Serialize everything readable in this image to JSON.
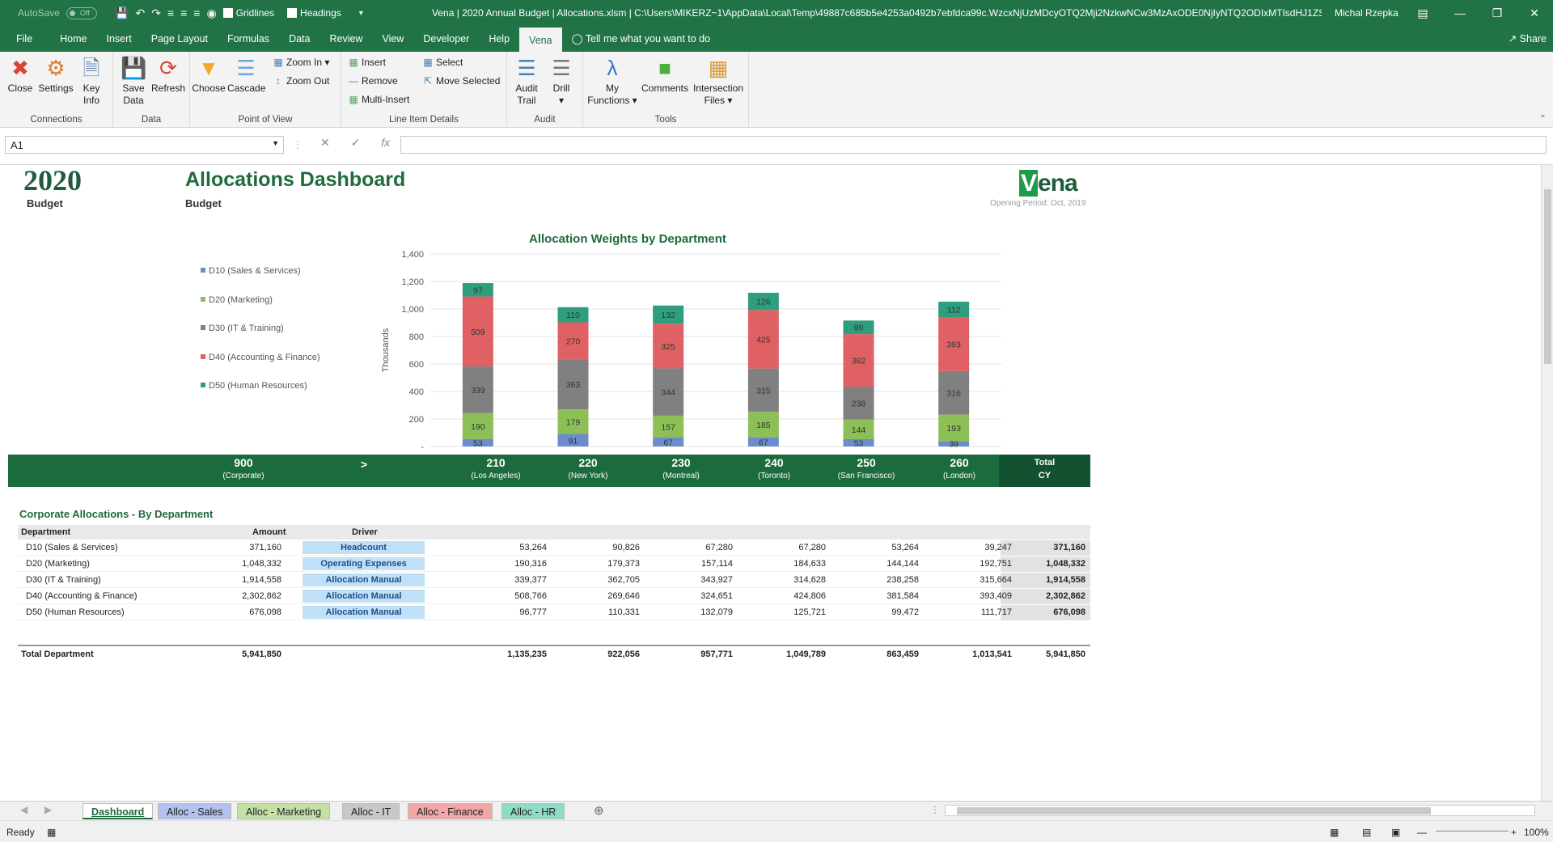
{
  "titlebar": {
    "autosave": "AutoSave",
    "autosave_state": "Off",
    "gridlines": "Gridlines",
    "headings": "Headings",
    "title": "Vena | 2020 Annual Budget | Allocations.xlsm | C:\\Users\\MIKERZ~1\\AppData\\Local\\Temp\\49887c685b5e4253a0492b7ebfdca99c.WzcxNjUzMDcyOTQ2Mji2NzkwNCw3MzAxODE0NjIyNTQ2ODIxMTIsdHJ1ZSwiY...",
    "user": "Michal Rzepka"
  },
  "tabs": [
    "File",
    "Home",
    "Insert",
    "Page Layout",
    "Formulas",
    "Data",
    "Review",
    "View",
    "Developer",
    "Help",
    "Vena"
  ],
  "tell_me": "Tell me what you want to do",
  "share": "Share",
  "ribbon": {
    "connections": {
      "label": "Connections",
      "close": "Close",
      "settings": "Settings",
      "key": "Key",
      "info": "Info"
    },
    "data": {
      "label": "Data",
      "save": "Save",
      "save2": "Data",
      "refresh": "Refresh"
    },
    "pov": {
      "label": "Point of View",
      "choose": "Choose",
      "cascade": "Cascade",
      "zoom_in": "Zoom In",
      "zoom_out": "Zoom Out"
    },
    "lid": {
      "label": "Line Item Details",
      "insert": "Insert",
      "remove": "Remove",
      "multi": "Multi-Insert",
      "select": "Select",
      "move": "Move Selected"
    },
    "audit": {
      "label": "Audit",
      "audit": "Audit",
      "trail": "Trail",
      "drill": "Drill"
    },
    "tools": {
      "label": "Tools",
      "my": "My",
      "functions": "Functions",
      "comments": "Comments",
      "intersection": "Intersection",
      "files": "Files"
    }
  },
  "namebox": "A1",
  "sheet": {
    "year": "2020",
    "budget1": "Budget",
    "title": "Allocations Dashboard",
    "budget2": "Budget",
    "logo": "ena",
    "opening": "Opening Period: Oct, 2019"
  },
  "chart_data": {
    "type": "bar",
    "title": "Allocation Weights by Department",
    "ylabel": "Thousands",
    "ylim": [
      0,
      1400
    ],
    "yticks": [
      "-",
      "200",
      "400",
      "600",
      "800",
      "1,000",
      "1,200",
      "1,400"
    ],
    "categories": [
      "210",
      "220",
      "230",
      "240",
      "250",
      "260"
    ],
    "series": [
      {
        "name": "D10 (Sales & Services)",
        "color": "#6c8ccb",
        "values": [
          53,
          91,
          67,
          67,
          53,
          39
        ]
      },
      {
        "name": "D20 (Marketing)",
        "color": "#8dbf57",
        "values": [
          190,
          179,
          157,
          185,
          144,
          193
        ]
      },
      {
        "name": "D30 (IT & Training)",
        "color": "#808080",
        "values": [
          339,
          363,
          344,
          315,
          238,
          316
        ]
      },
      {
        "name": "D40 (Accounting & Finance)",
        "color": "#e06164",
        "values": [
          509,
          270,
          325,
          425,
          382,
          393
        ]
      },
      {
        "name": "D50 (Human Resources)",
        "color": "#2e9e7f",
        "values": [
          97,
          110,
          132,
          126,
          99,
          112
        ]
      }
    ]
  },
  "band": {
    "c0": "900",
    "c0s": "(Corporate)",
    "arrow": ">",
    "cols": [
      {
        "n": "210",
        "s": "(Los Angeles)"
      },
      {
        "n": "220",
        "s": "(New York)"
      },
      {
        "n": "230",
        "s": "(Montreal)"
      },
      {
        "n": "240",
        "s": "(Toronto)"
      },
      {
        "n": "250",
        "s": "(San Francisco)"
      },
      {
        "n": "260",
        "s": "(London)"
      }
    ],
    "tot1": "Total",
    "tot2": "CY"
  },
  "table": {
    "title": "Corporate Allocations - By Department",
    "h_dept": "Department",
    "h_amount": "Amount",
    "h_driver": "Driver",
    "rows": [
      {
        "dept": "D10 (Sales & Services)",
        "amount": "371,160",
        "driver": "Headcount",
        "vals": [
          "53,264",
          "90,826",
          "67,280",
          "67,280",
          "53,264",
          "39,247"
        ],
        "total": "371,160"
      },
      {
        "dept": "D20 (Marketing)",
        "amount": "1,048,332",
        "driver": "Operating Expenses",
        "vals": [
          "190,316",
          "179,373",
          "157,114",
          "184,633",
          "144,144",
          "192,751"
        ],
        "total": "1,048,332"
      },
      {
        "dept": "D30 (IT & Training)",
        "amount": "1,914,558",
        "driver": "Allocation Manual",
        "vals": [
          "339,377",
          "362,705",
          "343,927",
          "314,628",
          "238,258",
          "315,664"
        ],
        "total": "1,914,558"
      },
      {
        "dept": "D40 (Accounting & Finance)",
        "amount": "2,302,862",
        "driver": "Allocation Manual",
        "vals": [
          "508,766",
          "269,646",
          "324,651",
          "424,806",
          "381,584",
          "393,409"
        ],
        "total": "2,302,862"
      },
      {
        "dept": "D50 (Human Resources)",
        "amount": "676,098",
        "driver": "Allocation Manual",
        "vals": [
          "96,777",
          "110,331",
          "132,079",
          "125,721",
          "99,472",
          "111,717"
        ],
        "total": "676,098"
      }
    ],
    "total": {
      "label": "Total Department",
      "amount": "5,941,850",
      "vals": [
        "1,135,235",
        "922,056",
        "957,771",
        "1,049,789",
        "863,459",
        "1,013,541"
      ],
      "total": "5,941,850"
    }
  },
  "sheet_tabs": [
    {
      "label": "Dashboard",
      "color": "#ffffff"
    },
    {
      "label": "Alloc - Sales",
      "color": "#b4c0ee"
    },
    {
      "label": "Alloc - Marketing",
      "color": "#c4e0a4"
    },
    {
      "label": "Alloc - IT",
      "color": "#c8c8c8"
    },
    {
      "label": "Alloc - Finance",
      "color": "#f2a6a8"
    },
    {
      "label": "Alloc - HR",
      "color": "#8fdcc6"
    }
  ],
  "status": {
    "ready": "Ready",
    "zoom": "100%"
  }
}
